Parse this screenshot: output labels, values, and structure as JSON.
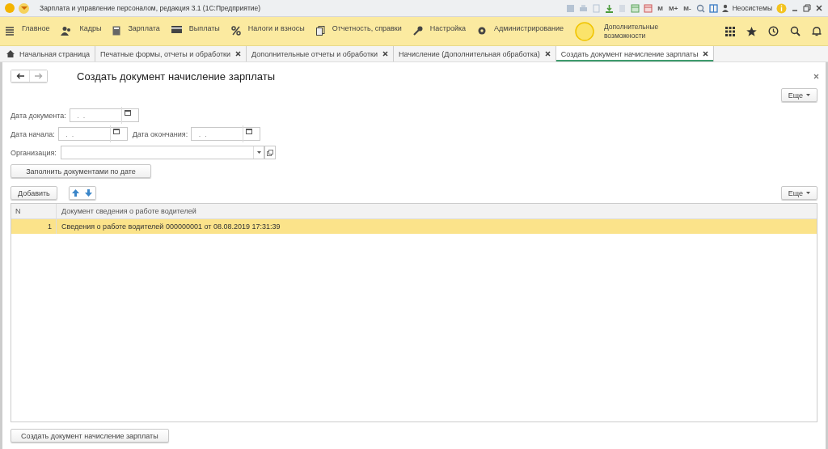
{
  "window": {
    "title": "Зарплата и управление персоналом, редакция 3.1  (1С:Предприятие)",
    "memory_buttons": [
      "M",
      "M+",
      "M-"
    ],
    "user": "Неосистемы"
  },
  "sections": [
    {
      "label": "Главное"
    },
    {
      "label": "Кадры"
    },
    {
      "label": "Зарплата"
    },
    {
      "label": "Выплаты"
    },
    {
      "label": "Налоги и взносы"
    },
    {
      "label": "Отчетность, справки"
    },
    {
      "label": "Настройка"
    },
    {
      "label": "Администрирование"
    },
    {
      "label": "Дополнительные возможности"
    }
  ],
  "tabs": [
    {
      "label": "Начальная страница",
      "home": true,
      "closable": false,
      "selected": false
    },
    {
      "label": "Печатные формы, отчеты и обработки",
      "home": false,
      "closable": true,
      "selected": false
    },
    {
      "label": "Дополнительные отчеты и обработки",
      "home": false,
      "closable": true,
      "selected": false
    },
    {
      "label": "Начисление (Дополнительная обработка)",
      "home": false,
      "closable": true,
      "selected": false
    },
    {
      "label": "Создать документ начисление зарплаты",
      "home": false,
      "closable": true,
      "selected": true
    }
  ],
  "form": {
    "title": "Создать документ начисление зарплаты",
    "more_button": "Еще",
    "fields": {
      "doc_date": {
        "label": "Дата документа:",
        "value": " .  ."
      },
      "start_date": {
        "label": "Дата начала:",
        "value": " .  ."
      },
      "end_date": {
        "label": "Дата окончания:",
        "value": " .  ."
      },
      "organization": {
        "label": "Организация:"
      }
    },
    "fill_button": "Заполнить документами по дате",
    "add_button": "Добавить",
    "table_more_button": "Еще",
    "table": {
      "columns": [
        "N",
        "Документ сведения о работе водителей"
      ],
      "rows": [
        {
          "n": "1",
          "document": "Сведения о работе водителей 000000001 от 08.08.2019 17:31:39",
          "selected": true
        }
      ]
    },
    "create_button": "Создать документ начисление зарплаты"
  }
}
